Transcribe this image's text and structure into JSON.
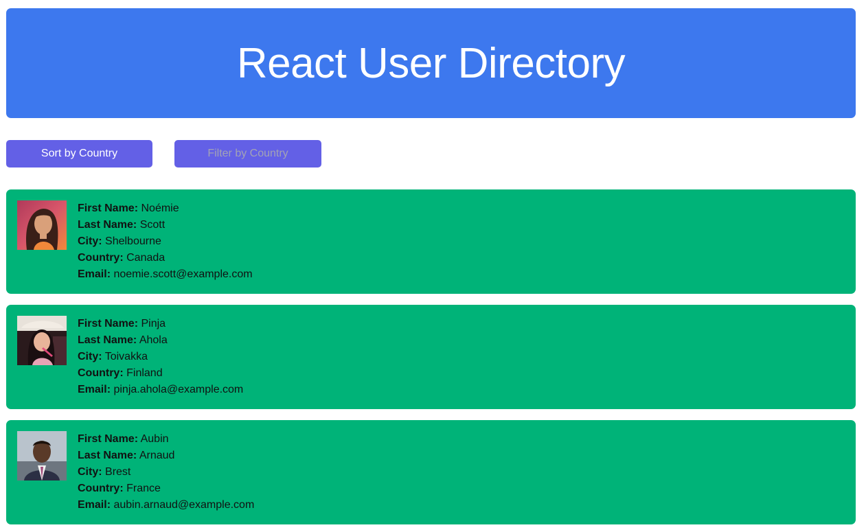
{
  "header": {
    "title": "React User Directory",
    "background_color": "#3d78ee"
  },
  "controls": {
    "sort_label": "Sort by Country",
    "filter_placeholder": "Filter by Country",
    "filter_value": "",
    "button_color": "#6360e6"
  },
  "labels": {
    "first_name": "First Name:",
    "last_name": "Last Name:",
    "city": "City:",
    "country": "Country:",
    "email": "Email:"
  },
  "card_color": "#00b378",
  "users": [
    {
      "avatar_icon": "user-photo",
      "first_name": "Noémie",
      "last_name": "Scott",
      "city": "Shelbourne",
      "country": "Canada",
      "email": "noemie.scott@example.com"
    },
    {
      "avatar_icon": "user-photo",
      "first_name": "Pinja",
      "last_name": "Ahola",
      "city": "Toivakka",
      "country": "Finland",
      "email": "pinja.ahola@example.com"
    },
    {
      "avatar_icon": "user-photo",
      "first_name": "Aubin",
      "last_name": "Arnaud",
      "city": "Brest",
      "country": "France",
      "email": "aubin.arnaud@example.com"
    }
  ]
}
